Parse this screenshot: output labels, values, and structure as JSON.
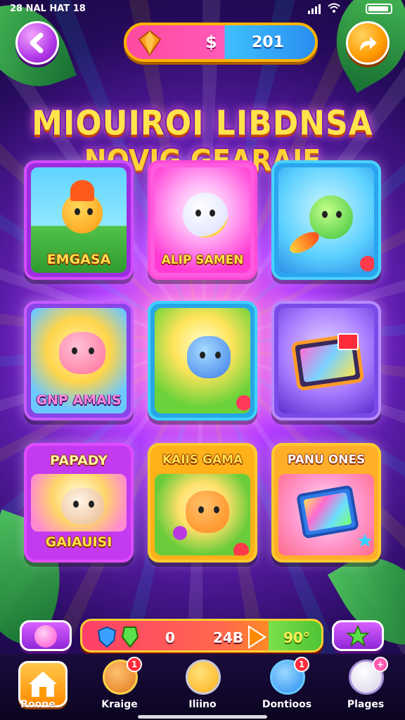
{
  "status_bar": {
    "clock": "28 NAL HAT 18"
  },
  "top_bar": {
    "currency_symbol": "$",
    "coin_amount": "201"
  },
  "title": {
    "line1": "MIOUIROI LIBDNSA",
    "line2": "NOVIG GEARAIE"
  },
  "cards": [
    {
      "label": "EMGASA"
    },
    {
      "label": "ALIP SAMEN"
    },
    {
      "label": ""
    },
    {
      "label": "GNP AMAIS"
    },
    {
      "label": ""
    },
    {
      "label": ""
    },
    {
      "label": "PAPADY",
      "sublabel": "GAIAUISI"
    },
    {
      "label": "KAIIS GAMA"
    },
    {
      "label": "PANU ONES"
    }
  ],
  "bottom_strip": {
    "value_a": "0",
    "value_b": "24B",
    "value_c": "90°"
  },
  "tabs": [
    {
      "label": "Roone"
    },
    {
      "label": "Kraige",
      "badge": "1"
    },
    {
      "label": "Iliino"
    },
    {
      "label": "Dontioos",
      "badge": "1"
    },
    {
      "label": "Plages",
      "badge": "+"
    }
  ],
  "colors": {
    "accent_pink": "#ff4aa0",
    "accent_blue": "#2a8ef0",
    "accent_gold": "#ffb300",
    "accent_purple": "#b43ae8"
  }
}
